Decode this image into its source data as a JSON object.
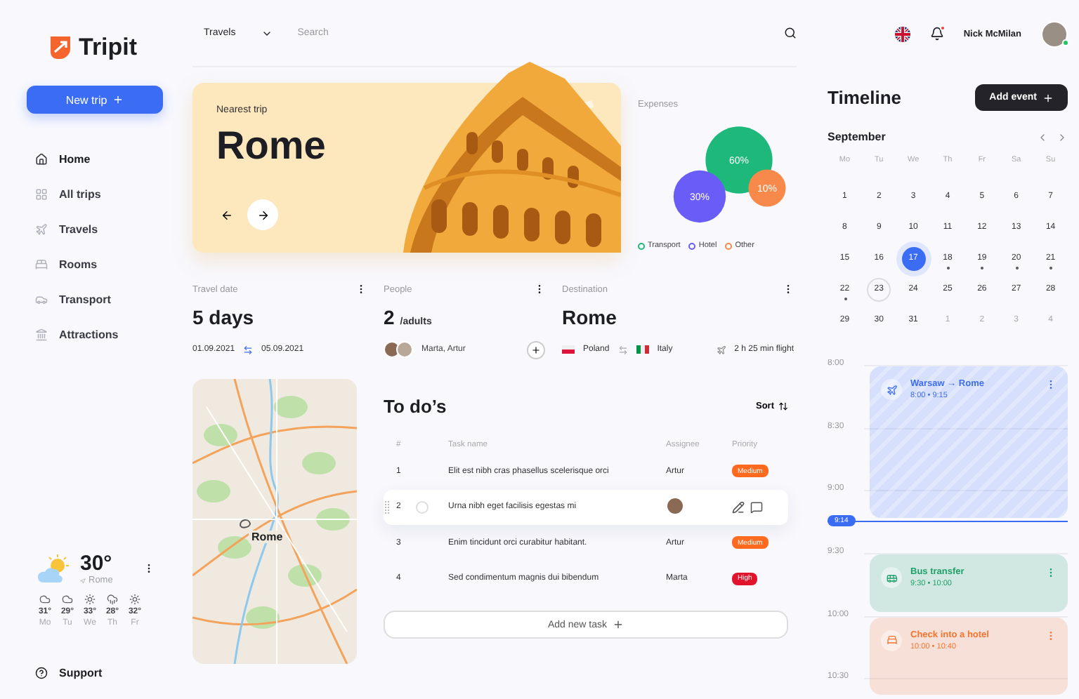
{
  "sidebar": {
    "logo": "Tripit",
    "new_trip_button": "New trip",
    "nav": [
      {
        "label": "Home",
        "selected": true
      },
      {
        "label": "All trips",
        "selected": false
      },
      {
        "label": "Travels",
        "selected": false
      },
      {
        "label": "Rooms",
        "selected": false
      },
      {
        "label": "Transport",
        "selected": false
      },
      {
        "label": "Attractions",
        "selected": false
      }
    ],
    "weather": {
      "temperature": "30°",
      "location": "Rome",
      "forecast": [
        {
          "kind": "cloud",
          "temp": "31°",
          "day": "Mo"
        },
        {
          "kind": "cloud",
          "temp": "29°",
          "day": "Tu"
        },
        {
          "kind": "sun",
          "temp": "33°",
          "day": "We"
        },
        {
          "kind": "rain",
          "temp": "28°",
          "day": "Th"
        },
        {
          "kind": "sun",
          "temp": "32°",
          "day": "Fr"
        }
      ]
    },
    "support": "Support"
  },
  "header": {
    "category": "Travels",
    "search": {
      "placeholder": "Search"
    },
    "has_notification": true,
    "user": {
      "name": "Nick McMilan",
      "online": true
    }
  },
  "hero": {
    "caption": "Nearest trip",
    "title": "Rome"
  },
  "expenses": {
    "title": "Expenses",
    "items": [
      {
        "name": "Transport",
        "value": "60%",
        "color": "#1db87a"
      },
      {
        "name": "Hotel",
        "value": "30%",
        "color": "#6a5cf6"
      },
      {
        "name": "Other",
        "value": "10%",
        "color": "#f7894a"
      }
    ]
  },
  "travel_date": {
    "title": "Travel date",
    "value": "5 days",
    "from": "01.09.2021",
    "to": "05.09.2021"
  },
  "people": {
    "title": "People",
    "value": "2",
    "unit": "/adults",
    "names": "Marta, Artur"
  },
  "destination": {
    "title": "Destination",
    "value": "Rome",
    "from": "Poland",
    "to": "Italy",
    "flight": "2 h 25 min flight"
  },
  "map": {
    "label": "Rome"
  },
  "todos": {
    "title": "To do’s",
    "sort": "Sort",
    "columns": [
      "#",
      "Task name",
      "Assignee",
      "Priority"
    ],
    "rows": [
      {
        "number": "1",
        "task": "Elit est nibh cras phasellus scelerisque orci",
        "assignee": "Artur",
        "priority": {
          "label": "Medium",
          "color": "#ff6a1f"
        },
        "selected": false
      },
      {
        "number": "2",
        "task": "Urna nibh eget facilisis egestas mi",
        "checked": false,
        "selected": true
      },
      {
        "number": "3",
        "task": "Enim tincidunt orci curabitur habitant.",
        "assignee": "Artur",
        "priority": {
          "label": "Medium",
          "color": "#ff6a1f"
        },
        "selected": false
      },
      {
        "number": "4",
        "task": "Sed condimentum magnis dui bibendum",
        "assignee": "Marta",
        "priority": {
          "label": "High",
          "color": "#e0142c"
        },
        "selected": false
      }
    ],
    "add_button": "Add new task"
  },
  "timeline": {
    "title": "Timeline",
    "add_button": "Add event",
    "month": "September",
    "weekdays": [
      "Mo",
      "Tu",
      "We",
      "Th",
      "Fr",
      "Sa",
      "Su"
    ],
    "days": [
      {
        "day": "1",
        "muted": false,
        "selected": false,
        "today": false,
        "event": false
      },
      {
        "day": "2",
        "muted": false,
        "selected": false,
        "today": false,
        "event": false
      },
      {
        "day": "3",
        "muted": false,
        "selected": false,
        "today": false,
        "event": false
      },
      {
        "day": "4",
        "muted": false,
        "selected": false,
        "today": false,
        "event": false
      },
      {
        "day": "5",
        "muted": false,
        "selected": false,
        "today": false,
        "event": false
      },
      {
        "day": "6",
        "muted": false,
        "selected": false,
        "today": false,
        "event": false
      },
      {
        "day": "7",
        "muted": false,
        "selected": false,
        "today": false,
        "event": false
      },
      {
        "day": "8",
        "muted": false,
        "selected": false,
        "today": false,
        "event": false
      },
      {
        "day": "9",
        "muted": false,
        "selected": false,
        "today": false,
        "event": false
      },
      {
        "day": "10",
        "muted": false,
        "selected": false,
        "today": false,
        "event": false
      },
      {
        "day": "11",
        "muted": false,
        "selected": false,
        "today": false,
        "event": false
      },
      {
        "day": "12",
        "muted": false,
        "selected": false,
        "today": false,
        "event": false
      },
      {
        "day": "13",
        "muted": false,
        "selected": false,
        "today": false,
        "event": false
      },
      {
        "day": "14",
        "muted": false,
        "selected": false,
        "today": false,
        "event": false
      },
      {
        "day": "15",
        "muted": false,
        "selected": false,
        "today": false,
        "event": false
      },
      {
        "day": "16",
        "muted": false,
        "selected": false,
        "today": false,
        "event": false
      },
      {
        "day": "17",
        "muted": false,
        "selected": true,
        "today": false,
        "event": false
      },
      {
        "day": "18",
        "muted": false,
        "selected": false,
        "today": false,
        "event": true
      },
      {
        "day": "19",
        "muted": false,
        "selected": false,
        "today": false,
        "event": true
      },
      {
        "day": "20",
        "muted": false,
        "selected": false,
        "today": false,
        "event": true
      },
      {
        "day": "21",
        "muted": false,
        "selected": false,
        "today": false,
        "event": true
      },
      {
        "day": "22",
        "muted": false,
        "selected": false,
        "today": false,
        "event": true
      },
      {
        "day": "23",
        "muted": false,
        "selected": false,
        "today": true,
        "event": false
      },
      {
        "day": "24",
        "muted": false,
        "selected": false,
        "today": false,
        "event": false
      },
      {
        "day": "25",
        "muted": false,
        "selected": false,
        "today": false,
        "event": false
      },
      {
        "day": "26",
        "muted": false,
        "selected": false,
        "today": false,
        "event": false
      },
      {
        "day": "27",
        "muted": false,
        "selected": false,
        "today": false,
        "event": false
      },
      {
        "day": "28",
        "muted": false,
        "selected": false,
        "today": false,
        "event": false
      },
      {
        "day": "29",
        "muted": false,
        "selected": false,
        "today": false,
        "event": false
      },
      {
        "day": "30",
        "muted": false,
        "selected": false,
        "today": false,
        "event": false
      },
      {
        "day": "31",
        "muted": false,
        "selected": false,
        "today": false,
        "event": false
      },
      {
        "day": "1",
        "muted": true,
        "selected": false,
        "today": false,
        "event": false
      },
      {
        "day": "2",
        "muted": true,
        "selected": false,
        "today": false,
        "event": false
      },
      {
        "day": "3",
        "muted": true,
        "selected": false,
        "today": false,
        "event": false
      },
      {
        "day": "4",
        "muted": true,
        "selected": false,
        "today": false,
        "event": false
      }
    ],
    "hours": [
      "8:00",
      "8:30",
      "9:00",
      "9:30",
      "10:00",
      "10:30"
    ],
    "now": "9:14",
    "time_separator": "•",
    "events": [
      {
        "kind": "flight",
        "from": "Warsaw",
        "arrow": "→",
        "to": "Rome",
        "start": "8:00",
        "end": "9:15",
        "color": "#3d6df2"
      },
      {
        "kind": "bus",
        "title": "Bus transfer",
        "start": "9:30",
        "end": "10:00",
        "color": "#1fa06a"
      },
      {
        "kind": "hotel",
        "title": "Check into a hotel",
        "start": "10:00",
        "end": "10:40",
        "color": "#f5742f"
      }
    ]
  }
}
